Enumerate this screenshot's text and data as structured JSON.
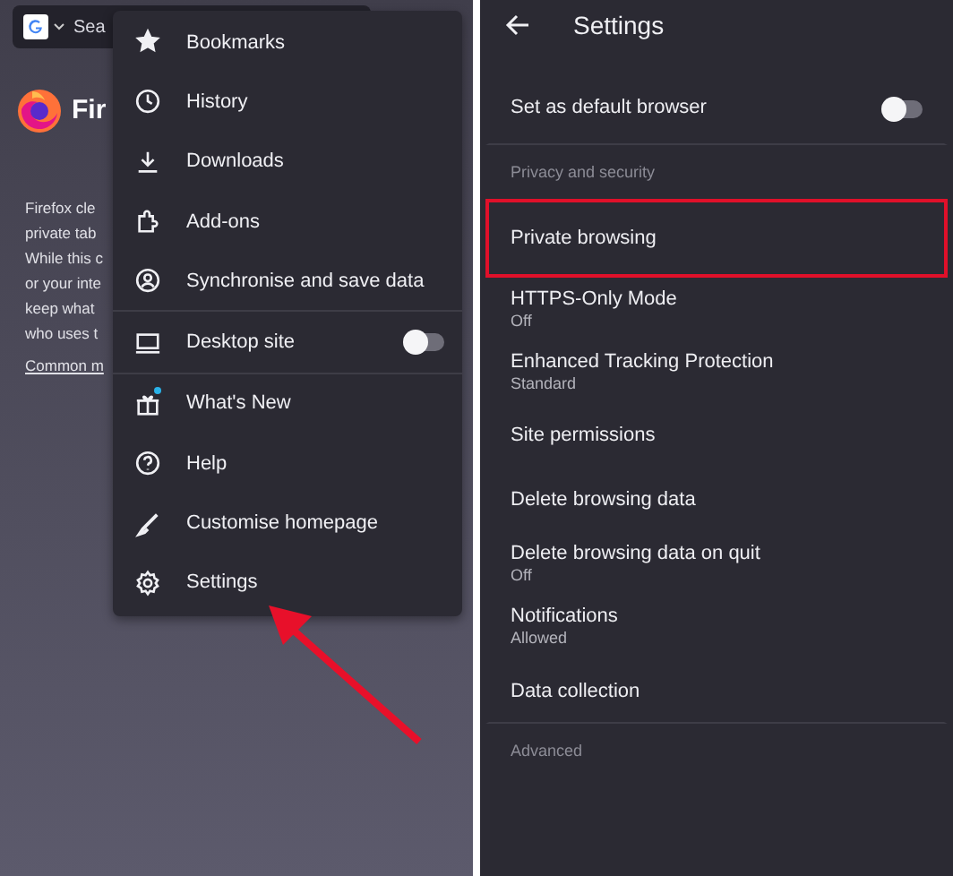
{
  "browser": {
    "search_placeholder": "Sea",
    "brand": "Fir",
    "intro_lines": [
      "Firefox cle",
      "private tab",
      "While this c",
      "or your inte",
      "keep what",
      "who uses t"
    ],
    "link": "Common m"
  },
  "menu": {
    "items": [
      {
        "label": "Bookmarks",
        "kind": "item",
        "badge": false
      },
      {
        "label": "History",
        "kind": "item",
        "badge": false
      },
      {
        "label": "Downloads",
        "kind": "item",
        "badge": false
      },
      {
        "label": "Add-ons",
        "kind": "item",
        "badge": false
      },
      {
        "label": "Synchronise and save data",
        "kind": "item",
        "badge": false
      },
      {
        "label": "Desktop site",
        "kind": "toggle",
        "on": false,
        "badge": false
      },
      {
        "label": "What's New",
        "kind": "item",
        "badge": true
      },
      {
        "label": "Help",
        "kind": "item",
        "badge": false
      },
      {
        "label": "Customise homepage",
        "kind": "item",
        "badge": false
      },
      {
        "label": "Settings",
        "kind": "item",
        "badge": false
      }
    ]
  },
  "settings": {
    "title": "Settings",
    "rows": [
      {
        "kind": "toggle",
        "label": "Set as default browser",
        "on": false,
        "highlighted": false
      },
      {
        "kind": "section",
        "label": "Privacy and security"
      },
      {
        "kind": "item",
        "label": "Private browsing",
        "highlighted": true
      },
      {
        "kind": "item",
        "label": "HTTPS-Only Mode",
        "value": "Off",
        "highlighted": false
      },
      {
        "kind": "item",
        "label": "Enhanced Tracking Protection",
        "value": "Standard",
        "highlighted": false
      },
      {
        "kind": "item",
        "label": "Site permissions",
        "highlighted": false
      },
      {
        "kind": "item",
        "label": "Delete browsing data",
        "highlighted": false
      },
      {
        "kind": "item",
        "label": "Delete browsing data on quit",
        "value": "Off",
        "highlighted": false
      },
      {
        "kind": "item",
        "label": "Notifications",
        "value": "Allowed",
        "highlighted": false
      },
      {
        "kind": "item",
        "label": "Data collection",
        "highlighted": false
      },
      {
        "kind": "section",
        "label": "Advanced"
      }
    ]
  }
}
